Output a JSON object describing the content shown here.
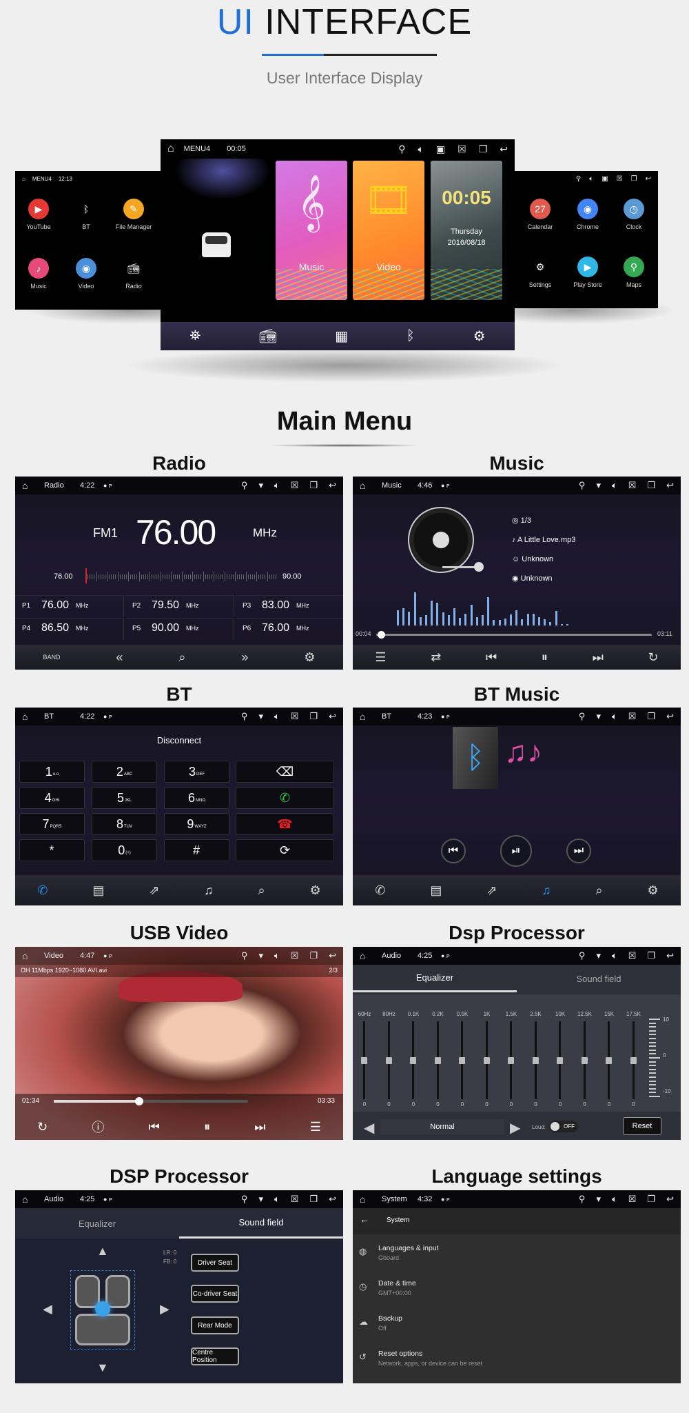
{
  "header": {
    "title_accent": "UI",
    "title_rest": " INTERFACE",
    "subtitle": "User Interface Display"
  },
  "hero": {
    "left": {
      "status": {
        "title": "MENU4",
        "time": "12:13"
      },
      "apps": [
        {
          "label": "YouTube",
          "icon": "youtube-icon",
          "color": "#e53935"
        },
        {
          "label": "BT",
          "icon": "bluetooth-icon",
          "color": "#000000"
        },
        {
          "label": "File Manager",
          "icon": "folder-icon",
          "color": "#f5a623"
        },
        {
          "label": "Music",
          "icon": "music-icon",
          "color": "#e84a77"
        },
        {
          "label": "Video",
          "icon": "video-icon",
          "color": "#4a90d9"
        },
        {
          "label": "Radio",
          "icon": "radio-icon",
          "color": "#000000"
        }
      ]
    },
    "center": {
      "status": {
        "title": "MENU4",
        "time": "00:05"
      },
      "cards": [
        {
          "label": "Music"
        },
        {
          "label": "Video"
        }
      ],
      "clock": {
        "time": "00:05",
        "day": "Thursday",
        "date": "2016/08/18"
      },
      "dock": [
        "navigation-icon",
        "radio-icon",
        "apps-icon",
        "bluetooth-icon",
        "settings-icon"
      ]
    },
    "right": {
      "apps": [
        {
          "label": "Calendar",
          "icon": "calendar-icon",
          "glyph": "27",
          "color": "#e25a4e"
        },
        {
          "label": "Chrome",
          "icon": "chrome-icon",
          "glyph": "◉",
          "color": "#4285f4"
        },
        {
          "label": "Clock",
          "icon": "clock-icon",
          "glyph": "◷",
          "color": "#5a9bd5"
        },
        {
          "label": "Settings",
          "icon": "settings-icon",
          "glyph": "⚙",
          "color": "#000000"
        },
        {
          "label": "Play Store",
          "icon": "play-store-icon",
          "glyph": "▶",
          "color": "#2fb7e8"
        },
        {
          "label": "Maps",
          "icon": "maps-icon",
          "glyph": "⚲",
          "color": "#34a853"
        }
      ]
    }
  },
  "main_menu_title": "Main Menu",
  "sections": {
    "radio": "Radio",
    "music": "Music",
    "bt": "BT",
    "bt_music": "BT Music",
    "usb_video": "USB Video",
    "dsp": "Dsp Processor",
    "dsp2": "DSP Processor",
    "language": "Language settings"
  },
  "radio": {
    "status": {
      "title": "Radio",
      "time": "4:22"
    },
    "band": "FM1",
    "frequency": "76.00",
    "unit": "MHz",
    "range_min": "76.00",
    "range_max": "90.00",
    "presets": [
      {
        "label": "P1",
        "value": "76.00",
        "unit": "MHz"
      },
      {
        "label": "P2",
        "value": "79.50",
        "unit": "MHz"
      },
      {
        "label": "P3",
        "value": "83.00",
        "unit": "MHz"
      },
      {
        "label": "P4",
        "value": "86.50",
        "unit": "MHz"
      },
      {
        "label": "P5",
        "value": "90.00",
        "unit": "MHz"
      },
      {
        "label": "P6",
        "value": "76.00",
        "unit": "MHz"
      }
    ],
    "band_button": "BAND"
  },
  "music": {
    "status": {
      "title": "Music",
      "time": "4:46"
    },
    "track_index": "1/3",
    "file": "A Little Love.mp3",
    "artist": "Unknown",
    "album": "Unknown",
    "elapsed": "00:04",
    "total": "03:11",
    "progress": 0.02
  },
  "bt": {
    "status": {
      "title": "BT",
      "time": "4:22"
    },
    "state": "Disconnect",
    "keys": [
      {
        "d": "1",
        "s": "o.o"
      },
      {
        "d": "2",
        "s": "ABC"
      },
      {
        "d": "3",
        "s": "DEF"
      },
      {
        "d": "4",
        "s": "GHI"
      },
      {
        "d": "5",
        "s": "JKL"
      },
      {
        "d": "6",
        "s": "MNO"
      },
      {
        "d": "7",
        "s": "PQRS"
      },
      {
        "d": "8",
        "s": "TUV"
      },
      {
        "d": "9",
        "s": "WXYZ"
      },
      {
        "d": "*",
        "s": ""
      },
      {
        "d": "0",
        "s": "(+)"
      },
      {
        "d": "#",
        "s": ""
      }
    ],
    "accent": "#2196f3"
  },
  "bt_music": {
    "status": {
      "title": "BT",
      "time": "4:23"
    }
  },
  "video": {
    "status": {
      "title": "Video",
      "time": "4:47"
    },
    "file": "OH 11Mbps 1920~1080 AVI.avi",
    "index": "2/3",
    "elapsed": "01:34",
    "total": "03:33",
    "progress": 0.44
  },
  "dsp": {
    "status": {
      "title": "Audio",
      "time": "4:25"
    },
    "tabs": [
      "Equalizer",
      "Sound field"
    ],
    "bands": [
      {
        "f": "60Hz",
        "v": "0"
      },
      {
        "f": "80Hz",
        "v": "0"
      },
      {
        "f": "0.1K",
        "v": "0"
      },
      {
        "f": "0.2K",
        "v": "0"
      },
      {
        "f": "0.5K",
        "v": "0"
      },
      {
        "f": "1K",
        "v": "0"
      },
      {
        "f": "1.5K",
        "v": "0"
      },
      {
        "f": "2.5K",
        "v": "0"
      },
      {
        "f": "10K",
        "v": "0"
      },
      {
        "f": "12.5K",
        "v": "0"
      },
      {
        "f": "15K",
        "v": "0"
      },
      {
        "f": "17.5K",
        "v": "0"
      }
    ],
    "scale": [
      "10",
      "0",
      "-10"
    ],
    "preset": "Normal",
    "loud_label": "Loud:",
    "loud_state": "OFF",
    "reset": "Reset"
  },
  "soundfield": {
    "status": {
      "title": "Audio",
      "time": "4:25"
    },
    "tabs": [
      "Equalizer",
      "Sound field"
    ],
    "lr": "LR: 0",
    "fb": "FB: 0",
    "buttons": [
      "Driver Seat",
      "Co-driver Seat",
      "Rear Mode",
      "Centre Position"
    ]
  },
  "language": {
    "status": {
      "title": "System",
      "time": "4:32"
    },
    "header": "System",
    "items": [
      {
        "title": "Languages & input",
        "sub": "Gboard",
        "icon": "globe-icon",
        "glyph": "◍"
      },
      {
        "title": "Date & time",
        "sub": "GMT+00:00",
        "icon": "clock-icon",
        "glyph": "◷"
      },
      {
        "title": "Backup",
        "sub": "Off",
        "icon": "cloud-upload-icon",
        "glyph": "☁"
      },
      {
        "title": "Reset options",
        "sub": "Network, apps, or device can be reset",
        "icon": "history-icon",
        "glyph": "↺"
      }
    ]
  }
}
